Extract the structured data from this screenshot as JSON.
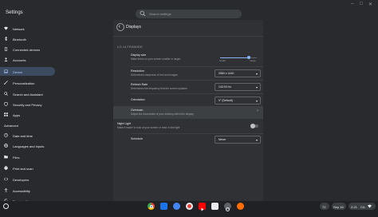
{
  "app": {
    "title": "Settings",
    "window_controls": [
      "–",
      "□",
      "✕"
    ]
  },
  "search": {
    "placeholder": "Search settings"
  },
  "sidebar": {
    "items": [
      {
        "label": "Network",
        "icon": "wifi-icon",
        "active": false
      },
      {
        "label": "Bluetooth",
        "icon": "bluetooth-icon",
        "active": false
      },
      {
        "label": "Connected devices",
        "icon": "phone-icon",
        "active": false
      },
      {
        "label": "Accounts",
        "icon": "person-icon",
        "active": false
      },
      {
        "label": "Device",
        "icon": "laptop-icon",
        "active": true
      },
      {
        "label": "Personalization",
        "icon": "brush-icon",
        "active": false
      },
      {
        "label": "Search and Assistant",
        "icon": "search-icon",
        "active": false
      },
      {
        "label": "Security and Privacy",
        "icon": "shield-icon",
        "active": false
      },
      {
        "label": "Apps",
        "icon": "apps-icon",
        "active": false
      }
    ],
    "advanced_label": "Advanced",
    "advanced_items": [
      {
        "label": "Date and time",
        "icon": "clock-icon"
      },
      {
        "label": "Languages and inputs",
        "icon": "globe-icon"
      },
      {
        "label": "Files",
        "icon": "folder-icon"
      },
      {
        "label": "Print and scan",
        "icon": "printer-icon"
      },
      {
        "label": "Developers",
        "icon": "code-icon"
      },
      {
        "label": "Accessibility",
        "icon": "accessibility-icon"
      },
      {
        "label": "Reset settings",
        "icon": "reset-icon"
      }
    ]
  },
  "displays": {
    "back_icon": "back-arrow-icon",
    "title": "Displays",
    "monitor_name": "LG ULTRAWIDE",
    "display_size": {
      "title": "Display size",
      "desc": "Make items on your screen smaller or larger",
      "min_label": "Small",
      "max_label": "Large",
      "value_fraction": 0.78
    },
    "resolution": {
      "title": "Resolution",
      "desc": "Determines sharpness of text and images",
      "value": "2560 x 1440"
    },
    "refresh_rate": {
      "title": "Refresh Rate",
      "desc": "Determines the frequency that the screen updates",
      "value": "143.93 Hz"
    },
    "orientation": {
      "title": "Orientation",
      "value": "0° (Default)"
    },
    "overscan": {
      "title": "Overscan",
      "desc": "Adjust the boundaries of your desktop within the display",
      "chevron": "›"
    },
    "night_light": {
      "title": "Night Light",
      "desc": "Make it easier to look at your screen or read in dim light",
      "enabled": false
    },
    "schedule": {
      "title": "Schedule",
      "value": "Never"
    }
  },
  "shelf": {
    "apps": [
      {
        "icon": "chrome-icon",
        "color": "#ea4335"
      },
      {
        "icon": "files-icon",
        "color": "#1a73e8"
      },
      {
        "icon": "browser-icon",
        "color": "#4285f4"
      },
      {
        "icon": "record-icon",
        "color": "#e8eaed"
      },
      {
        "icon": "youtube-icon",
        "color": "#ff0000"
      },
      {
        "icon": "terminal-icon",
        "color": "#e8eaed"
      },
      {
        "icon": "settings-icon",
        "color": "#9aa0a6"
      },
      {
        "icon": "photos-icon",
        "color": "#ff6d00"
      }
    ],
    "tray_badge": "72",
    "date": "Sep 16",
    "time": "2:21",
    "locale": "CA"
  },
  "colors": {
    "accent": "#8ab4f8",
    "active_nav_bg": "#3b4a5e",
    "background": "#292a2d",
    "panel": "#303134"
  }
}
